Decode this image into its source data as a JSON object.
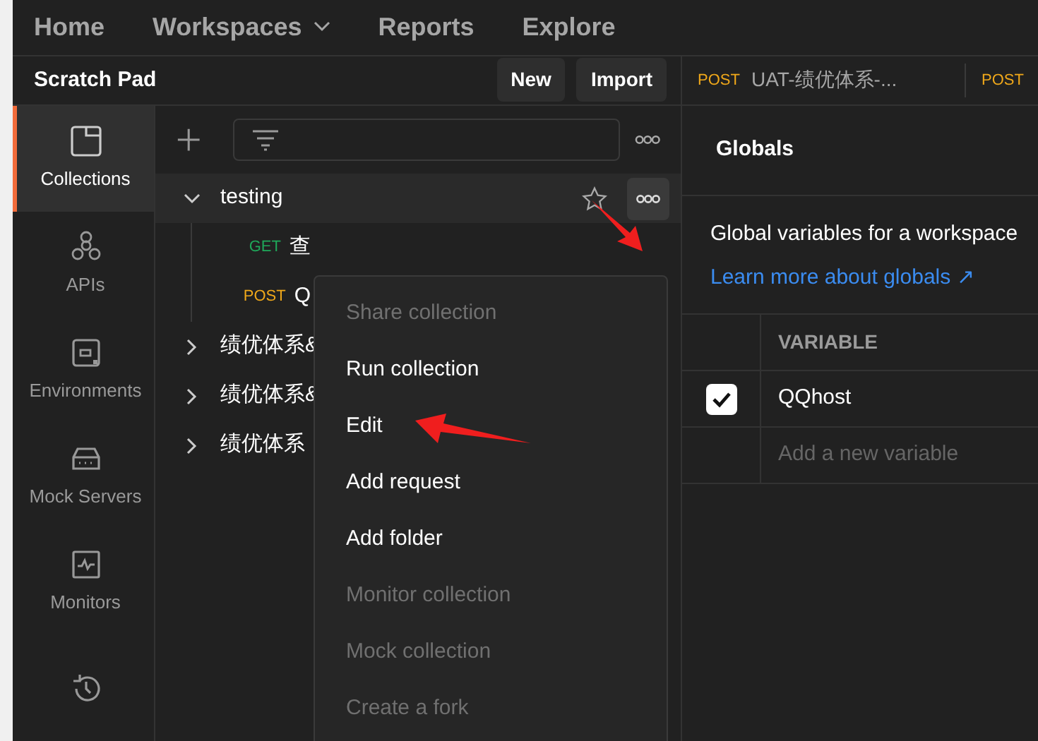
{
  "top_nav": [
    {
      "label": "Home",
      "dropdown": false
    },
    {
      "label": "Workspaces",
      "dropdown": true
    },
    {
      "label": "Reports",
      "dropdown": false
    },
    {
      "label": "Explore",
      "dropdown": false
    }
  ],
  "workspace": {
    "title": "Scratch Pad",
    "buttons": [
      "New",
      "Import"
    ]
  },
  "request_tabs": [
    {
      "method": "POST",
      "name": "UAT-绩优体系-..."
    },
    {
      "method": "POST"
    }
  ],
  "sidebar": {
    "items": [
      {
        "label": "Collections",
        "selected": true
      },
      {
        "label": "APIs",
        "selected": false
      },
      {
        "label": "Environments",
        "selected": false
      },
      {
        "label": "Mock Servers",
        "selected": false
      },
      {
        "label": "Monitors",
        "selected": false
      },
      {
        "selected": false
      }
    ]
  },
  "collections": [
    {
      "name": "testing",
      "expanded": true,
      "children": [
        {
          "method": "GET",
          "name": "查"
        },
        {
          "method": "POST",
          "name": "Q"
        }
      ]
    },
    {
      "name": "绩优体系&",
      "expanded": false
    },
    {
      "name": "绩优体系&",
      "expanded": false
    },
    {
      "name": "绩优体系",
      "expanded": false
    }
  ],
  "context_menu": [
    {
      "label": "Share collection",
      "disabled": true
    },
    {
      "label": "Run collection",
      "disabled": false
    },
    {
      "label": "Edit",
      "disabled": false
    },
    {
      "label": "Add request",
      "disabled": false
    },
    {
      "label": "Add folder",
      "disabled": false
    },
    {
      "label": "Monitor collection",
      "disabled": true
    },
    {
      "label": "Mock collection",
      "disabled": true
    },
    {
      "label": "Create a fork",
      "disabled": true
    }
  ],
  "globals": {
    "title": "Globals",
    "description": "Global variables for a workspace",
    "link": "Learn more about globals ↗",
    "column_header": "VARIABLE",
    "rows": [
      {
        "name": "QQhost",
        "checked": true
      }
    ],
    "new_row_placeholder": "Add a new variable"
  }
}
